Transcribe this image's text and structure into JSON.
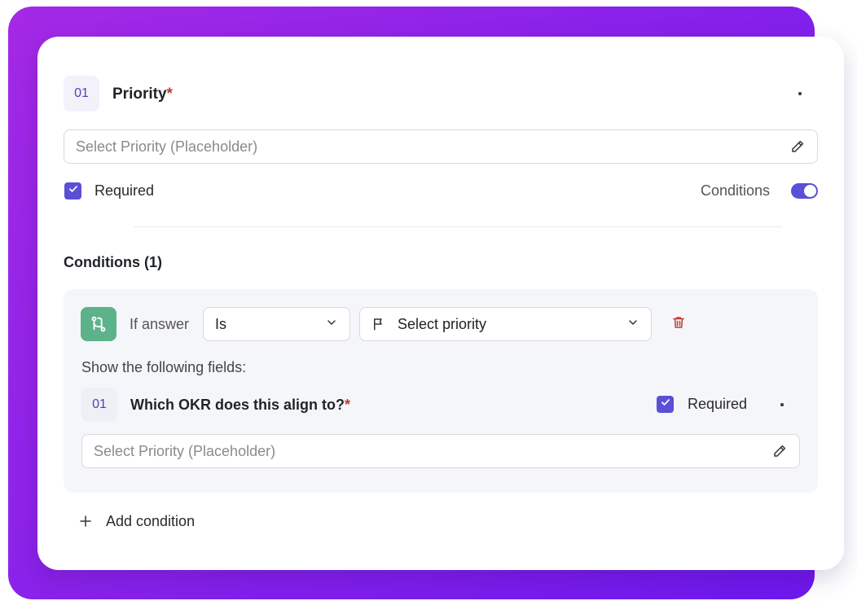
{
  "field": {
    "number": "01",
    "title": "Priority",
    "required_mark": "*",
    "placeholder": "Select Priority (Placeholder)",
    "required_label": "Required",
    "conditions_toggle_label": "Conditions",
    "conditions_enabled": true
  },
  "conditions": {
    "heading": "Conditions (1)",
    "rule": {
      "prefix": "If answer",
      "operator": "Is",
      "value_placeholder": "Select priority"
    },
    "show_fields_label": "Show the following fields:",
    "sub_field": {
      "number": "01",
      "title": "Which OKR does this align to?",
      "required_mark": "*",
      "required_label": "Required",
      "placeholder": "Select Priority (Placeholder)"
    },
    "add_label": "Add condition"
  },
  "colors": {
    "accent": "#5a4fd6",
    "branch_icon_bg": "#5cb389",
    "delete_red": "#c0392b",
    "gradient_start": "#a429e6",
    "gradient_end": "#6e18ee"
  },
  "icons": [
    "more-icon",
    "pencil-icon",
    "check-icon",
    "branch-icon",
    "chevron-down-icon",
    "flag-icon",
    "trash-icon",
    "plus-icon"
  ]
}
